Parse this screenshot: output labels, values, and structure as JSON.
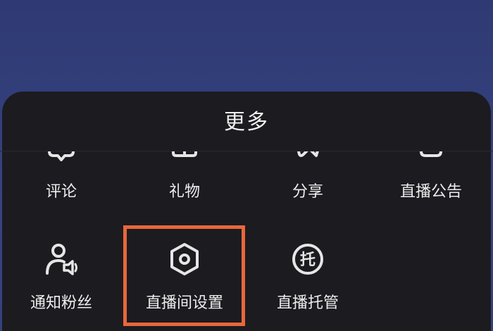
{
  "sheet": {
    "title": "更多"
  },
  "top_row": [
    {
      "label": "评论",
      "icon": "comment-icon"
    },
    {
      "label": "礼物",
      "icon": "gift-icon"
    },
    {
      "label": "分享",
      "icon": "share-icon"
    },
    {
      "label": "直播公告",
      "icon": "announcement-icon"
    }
  ],
  "bottom_row": [
    {
      "label": "通知粉丝",
      "icon": "notify-fans-icon"
    },
    {
      "label": "直播间设置",
      "icon": "hexagon-settings-icon"
    },
    {
      "label": "直播托管",
      "icon": "托",
      "icon_name": "live-hosting-icon"
    }
  ],
  "colors": {
    "background": "#34417c",
    "sheet": "#1c1b20",
    "text": "#ededed",
    "highlight": "#e8673b"
  }
}
